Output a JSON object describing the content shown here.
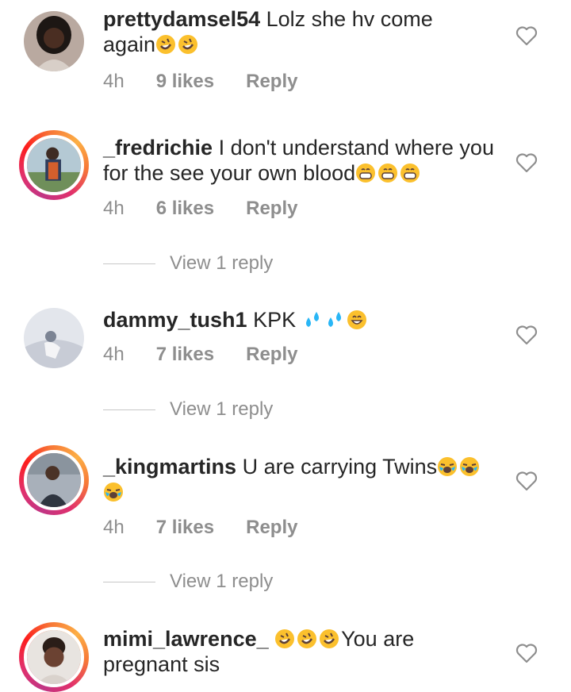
{
  "comments": [
    {
      "username": "prettydamsel54",
      "text_lines": [
        "Lolz she hv come",
        "again"
      ],
      "emojis_line": 1,
      "emoji_names": [
        "rofl-emoji",
        "rofl-emoji"
      ],
      "time": "4h",
      "likes": "9 likes",
      "reply": "Reply",
      "story_ring": false
    },
    {
      "username": "_fredrichie",
      "text_lines": [
        "I don't understand where you",
        "for the see your own blood"
      ],
      "emoji_names": [
        "grin-emoji",
        "grin-emoji",
        "grin-emoji"
      ],
      "time": "4h",
      "likes": "6 likes",
      "reply": "Reply",
      "view_replies": "View 1 reply",
      "story_ring": true
    },
    {
      "username": "dammy_tush1",
      "text_lines": [
        "KPK"
      ],
      "emoji_names": [
        "sweat-droplets-emoji",
        "sweat-droplets-emoji",
        "smile-emoji"
      ],
      "time": "4h",
      "likes": "7 likes",
      "reply": "Reply",
      "view_replies": "View 1 reply",
      "story_ring": false
    },
    {
      "username": "_kingmartins",
      "text_lines": [
        "U are carrying Twins"
      ],
      "emoji_names": [
        "loudly-crying-emoji",
        "loudly-crying-emoji",
        "loudly-crying-emoji"
      ],
      "time": "4h",
      "likes": "7 likes",
      "reply": "Reply",
      "view_replies": "View 1 reply",
      "story_ring": true
    },
    {
      "username": "mimi_lawrence_",
      "text_lines": [
        "You are",
        "pregnant sis"
      ],
      "emoji_names": [
        "rofl-emoji",
        "rofl-emoji",
        "rofl-emoji"
      ],
      "story_ring": true
    }
  ],
  "colors": {
    "text": "#262626",
    "meta": "#8e8e8e",
    "emoji_yellow": "#fbc02d",
    "droplet_blue": "#29b6f6"
  }
}
